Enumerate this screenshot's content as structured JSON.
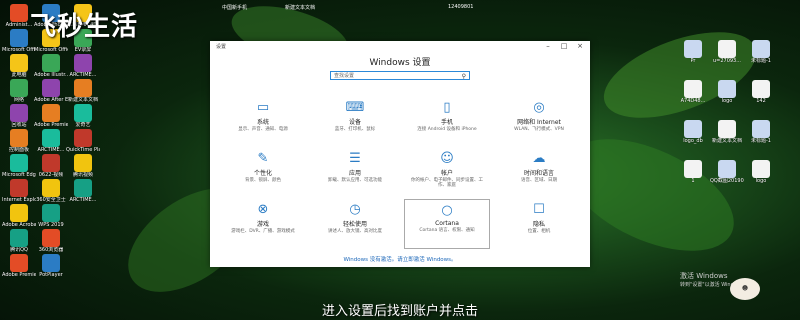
{
  "watermark_logo": "飞秒生活",
  "window": {
    "title": "设置",
    "heading": "Windows 设置",
    "search_placeholder": "查找设置",
    "footer_link": "Windows 没有激活。请立即激活 Windows。",
    "tiles": [
      {
        "name": "系统",
        "desc": "显示、声音、通知、电源",
        "icon": "monitor-icon"
      },
      {
        "name": "设备",
        "desc": "蓝牙、打印机、鼠标",
        "icon": "keyboard-icon"
      },
      {
        "name": "手机",
        "desc": "连接 Android 设备和 iPhone",
        "icon": "phone-icon"
      },
      {
        "name": "网络和 Internet",
        "desc": "WLAN、飞行模式、VPN",
        "icon": "globe-icon"
      },
      {
        "name": "个性化",
        "desc": "背景、锁屏、颜色",
        "icon": "brush-icon"
      },
      {
        "name": "应用",
        "desc": "卸载、默认应用、可选功能",
        "icon": "apps-icon"
      },
      {
        "name": "帐户",
        "desc": "你的帐户、电子邮件、同步设置、工作、家庭",
        "icon": "person-icon"
      },
      {
        "name": "时间和语言",
        "desc": "语音、区域、日期",
        "icon": "language-icon"
      },
      {
        "name": "游戏",
        "desc": "游戏栏、DVR、广播、游戏模式",
        "icon": "xbox-icon"
      },
      {
        "name": "轻松使用",
        "desc": "讲述人、放大镜、高对比度",
        "icon": "ease-of-access-icon"
      },
      {
        "name": "Cortana",
        "desc": "Cortana 语言、权限、通知",
        "icon": "cortana-icon"
      },
      {
        "name": "隐私",
        "desc": "位置、相机",
        "icon": "lock-icon"
      }
    ]
  },
  "desktop_icons_left": [
    "Administ...",
    "Microsoft Office Exc...",
    "此电脑",
    "网络",
    "回收站",
    "控制面板",
    "Microsoft Edge",
    "Internet Explorer",
    "Adobe Acroba...",
    "腾讯QQ",
    "Adobe Premie...",
    "Adobe Photosh...",
    "Microsoft Office Wo...",
    "Adobe Illustr...",
    "Adobe After Effects CC",
    "Adobe Premiere Pro",
    "ARCTIME...",
    "0622-视频",
    "360安全卫士",
    "WPS 2019",
    "360浏览器",
    "PotPlayer",
    "CINEMA 4D",
    "EV录屏",
    "ARCTIME...",
    "新建文本文档",
    "爱奇艺",
    "QuickTime Player",
    "腾讯视频",
    "ARCTIME..."
  ],
  "desktop_icons_right": [
    "Pr",
    "u=27093...",
    "未标题-1",
    "A74D48...",
    "logo",
    "142",
    "logo_db",
    "新建文本文档",
    "未标题-1",
    "1",
    "QQ截图20190625...",
    "logo"
  ],
  "tray_top": [
    "中国新手机",
    "新建文本文档",
    "12409801"
  ],
  "activate": {
    "line1": "激活 Windows",
    "line2": "转到\"设置\"以激活 Windows。"
  },
  "subtitle": "进入设置后找到账户并点击",
  "colors": {
    "accent": "#2b7cc4",
    "link": "#1a66b8",
    "background": "#1b4f1c"
  }
}
